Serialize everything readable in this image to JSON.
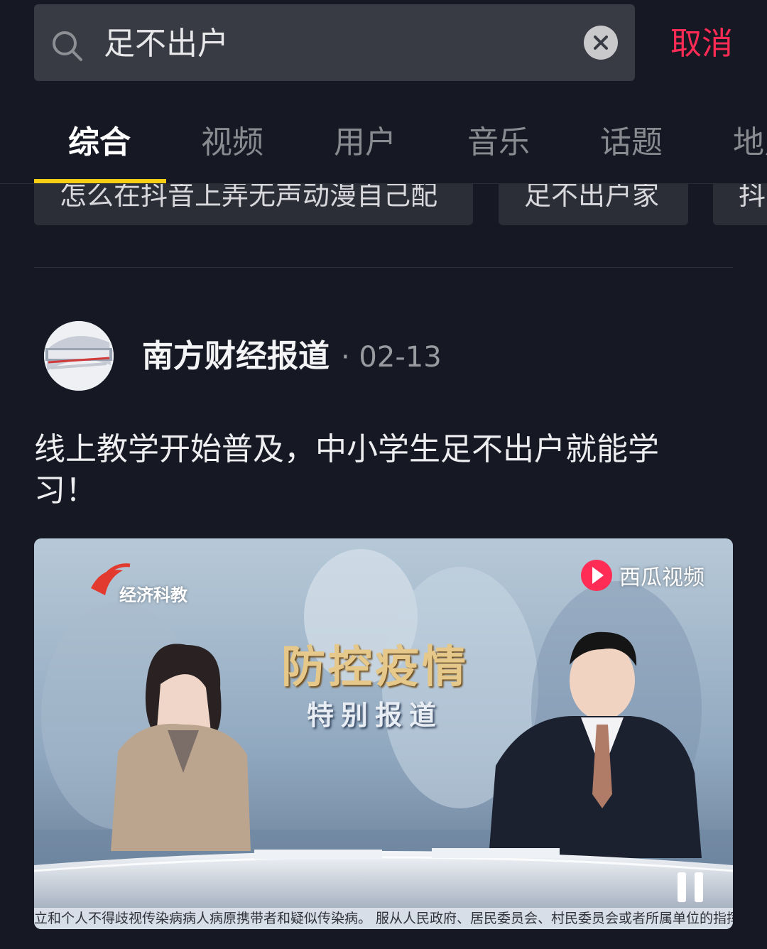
{
  "search": {
    "query": "足不出户",
    "cancel_label": "取消"
  },
  "tabs": [
    {
      "label": "综合",
      "active": true
    },
    {
      "label": "视频"
    },
    {
      "label": "用户"
    },
    {
      "label": "音乐"
    },
    {
      "label": "话题"
    },
    {
      "label": "地点"
    }
  ],
  "suggestions": [
    "怎么在抖音上弄无声动漫自己配",
    "足不出户家",
    "抖"
  ],
  "post": {
    "author": "南方财经报道",
    "date": "· 02-13",
    "title": "线上教学开始普及，中小学生足不出户就能学习！",
    "video": {
      "channel": "经济科教",
      "watermark": "西瓜视频",
      "headline": "防控疫情",
      "subheadline": "特别报道",
      "ticker": "立和个人不得歧视传染病病人病原携带者和疑似传染病。   服从人民政府、居民委员会、村民委员会或者所属单位的指挥"
    }
  },
  "colors": {
    "background": "#161823",
    "accent": "#fe2c55",
    "tab_indicator": "#face15"
  },
  "icons": {
    "search": "search-icon",
    "clear": "close-icon",
    "pause": "pause-icon",
    "watermark": "xigua-logo-icon"
  }
}
